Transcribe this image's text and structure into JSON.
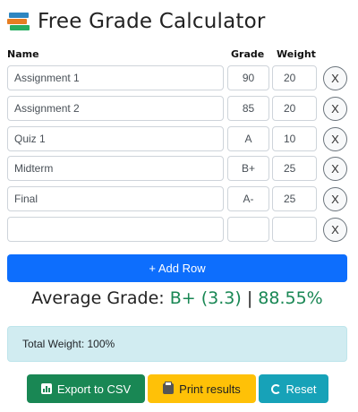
{
  "header": {
    "title": "Free Grade Calculator",
    "icon": "books-icon"
  },
  "table": {
    "columns": {
      "name": "Name",
      "grade": "Grade",
      "weight": "Weight"
    },
    "remove_label": "X",
    "rows": [
      {
        "name": "Assignment 1",
        "grade": "90",
        "weight": "20"
      },
      {
        "name": "Assignment 2",
        "grade": "85",
        "weight": "20"
      },
      {
        "name": "Quiz 1",
        "grade": "A",
        "weight": "10"
      },
      {
        "name": "Midterm",
        "grade": "B+",
        "weight": "25"
      },
      {
        "name": "Final",
        "grade": "A-",
        "weight": "25"
      },
      {
        "name": "",
        "grade": "",
        "weight": ""
      }
    ]
  },
  "add_row_label": "+ Add Row",
  "average": {
    "prefix": "Average Grade:",
    "letter_gpa": "B+ (3.3)",
    "separator": "|",
    "percent": "88.55%",
    "accent": "#198754"
  },
  "total_weight": "Total Weight: 100%",
  "actions": {
    "export_label": "Export to CSV",
    "print_label": "Print results",
    "reset_label": "Reset"
  },
  "colors": {
    "primary": "#0d6efd",
    "success": "#198754",
    "warning": "#ffc107",
    "info": "#17a2b8",
    "info_bg": "#d1ecf1"
  }
}
